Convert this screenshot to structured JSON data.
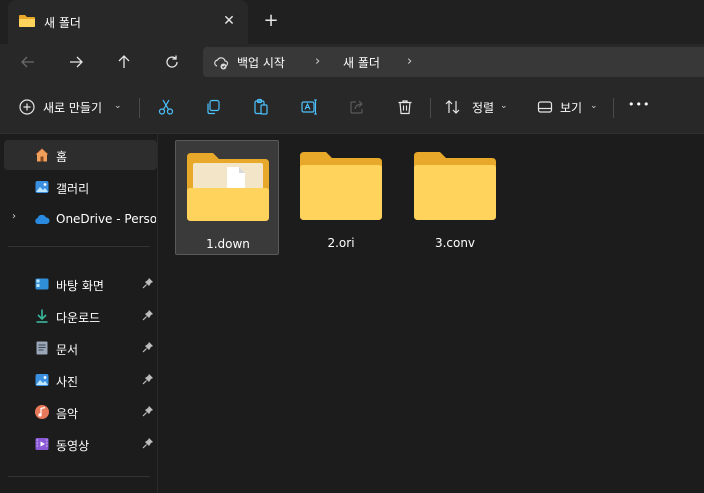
{
  "tab": {
    "title": "새 폴더",
    "close_symbol": "✕",
    "newtab_symbol": "+"
  },
  "address": {
    "segments": [
      "백업 시작",
      "새 폴더"
    ],
    "separator": "›"
  },
  "commands": {
    "new_label": "새로 만들기",
    "sort_label": "정렬",
    "view_label": "보기",
    "more_symbol": "•••",
    "dropdown_symbol": "⌄"
  },
  "sidebar": {
    "home": "홈",
    "gallery": "갤러리",
    "onedrive": "OneDrive - Personal",
    "expander": "›",
    "quick_access": [
      {
        "label": "바탕 화면",
        "icon": "desktop-icon",
        "color": "#2f8fd8"
      },
      {
        "label": "다운로드",
        "icon": "download-icon",
        "color": "#3ab89c"
      },
      {
        "label": "문서",
        "icon": "documents-icon",
        "color": "#9aa7b8"
      },
      {
        "label": "사진",
        "icon": "pictures-icon",
        "color": "#3a8fe0"
      },
      {
        "label": "음악",
        "icon": "music-icon",
        "color": "#e8785a"
      },
      {
        "label": "동영상",
        "icon": "videos-icon",
        "color": "#8a5ad6"
      }
    ]
  },
  "files": [
    {
      "name": "1.down",
      "selected": true,
      "has_content": true
    },
    {
      "name": "2.ori",
      "selected": false,
      "has_content": false
    },
    {
      "name": "3.conv",
      "selected": false,
      "has_content": false
    }
  ],
  "colors": {
    "folder_back": "#e8a82a",
    "folder_front": "#ffd35c",
    "accent": "#4cc2ff"
  }
}
